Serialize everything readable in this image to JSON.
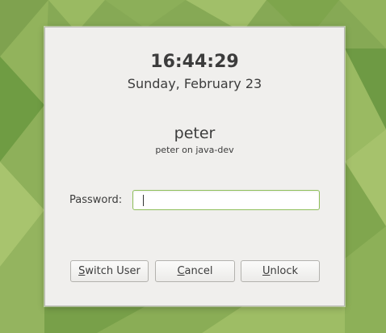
{
  "background": {
    "colors": [
      "#86a955",
      "#9aba62",
      "#78a049",
      "#6e9a44",
      "#a8c46e"
    ]
  },
  "lock": {
    "time": "16:44:29",
    "date": "Sunday, February 23",
    "username": "peter",
    "host_line": "peter on java-dev",
    "password_label": "Password:",
    "password_value": ""
  },
  "buttons": {
    "switch_user": {
      "mnemonic": "S",
      "rest": "witch User"
    },
    "cancel": {
      "mnemonic": "C",
      "rest": "ancel"
    },
    "unlock": {
      "mnemonic": "U",
      "rest": "nlock"
    }
  }
}
